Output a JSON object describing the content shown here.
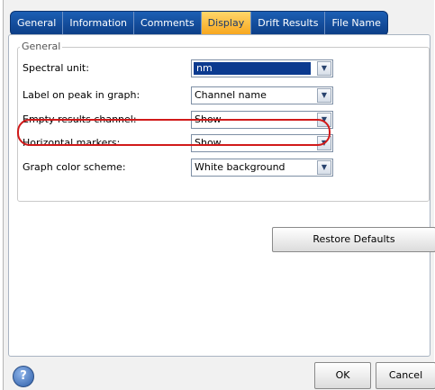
{
  "tabs": [
    {
      "label": "General",
      "active": false
    },
    {
      "label": "Information",
      "active": false
    },
    {
      "label": "Comments",
      "active": false
    },
    {
      "label": "Display",
      "active": true
    },
    {
      "label": "Drift Results",
      "active": false
    },
    {
      "label": "File Name",
      "active": false
    }
  ],
  "group": {
    "title": "General",
    "rows": [
      {
        "label": "Spectral unit:",
        "value": "nm",
        "selected": true
      },
      {
        "label": "Label on peak in graph:",
        "value": "Channel name",
        "highlighted": true
      },
      {
        "label": "Empty results channel:",
        "value": "Show"
      },
      {
        "label": "Horizontal markers:",
        "value": "Show"
      },
      {
        "label": "Graph color scheme:",
        "value": "White background"
      }
    ]
  },
  "buttons": {
    "restore_defaults": "Restore Defaults",
    "help": "?",
    "ok": "OK",
    "cancel": "Cancel"
  },
  "colors": {
    "tab_bar": "#0c3d86",
    "active_tab": "#f7a51c",
    "highlight": "#d11a1a",
    "selection": "#0b3a8f"
  }
}
